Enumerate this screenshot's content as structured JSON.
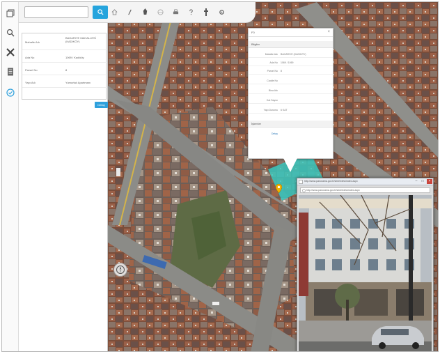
{
  "toolbar": {
    "search_value": "",
    "search_placeholder": "",
    "tools": [
      "home-icon",
      "pencil-icon",
      "lighthouse-icon",
      "globe-icon",
      "printer-icon",
      "help-icon",
      "tool-icon",
      "settings-icon"
    ]
  },
  "rail": {
    "items": [
      "layers-icon",
      "search-icon",
      "tools-icon",
      "document-icon",
      "shield-icon"
    ]
  },
  "info_panel": {
    "rows": [
      {
        "key": "Mahalle Adı",
        "value": "BAHARIYE MAHALLESİ (KADIKÖY)"
      },
      {
        "key": "Ada No",
        "value": "1069 / Kadıköy"
      },
      {
        "key": "Parsel No",
        "value": "8"
      },
      {
        "key": "Yapı Adı",
        "value": "Yumurtalı Apartmanı"
      }
    ],
    "detail_label": "Detay"
  },
  "popup": {
    "title": "F0",
    "close": "×",
    "section1": "Bilgiler",
    "rows": [
      {
        "key": "Mahalle Adı",
        "value": "BAHARIYE (KADIKÖY)"
      },
      {
        "key": "Ada No",
        "value": "1069 / 1069"
      },
      {
        "key": "Parsel No",
        "value": "8"
      },
      {
        "key": "Cadde No",
        "value": ""
      },
      {
        "key": "Bina Adı",
        "value": ""
      },
      {
        "key": "Kat Sayısı",
        "value": ""
      },
      {
        "key": "Yapı Durumu",
        "value": "6 KAT"
      }
    ],
    "section2": "İşlemler",
    "action": "Detay"
  },
  "street_view": {
    "title": "http://www.panorama.gov.tr/streetview/index.aspx",
    "url": "http://www.panorama.gov.tr/streetview/index.aspx",
    "minimize": "–",
    "maximize": "□",
    "close": "×"
  },
  "colors": {
    "accent": "#25a4dd",
    "highlight": "#38c8c0",
    "marker": "#f2b100"
  }
}
